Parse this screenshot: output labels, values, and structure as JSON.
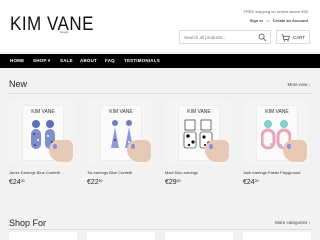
{
  "header": {
    "logo": "KIM VANE",
    "logo_sub": "design",
    "promo": "FREE shipping on orders above €30",
    "sign_in": "Sign in",
    "or": "or",
    "create_account": "Create an Account",
    "search_placeholder": "Search all products...",
    "cart_label": "CART"
  },
  "nav": {
    "items": [
      {
        "label": "HOME"
      },
      {
        "label": "SHOP ▾"
      },
      {
        "label": "SALE"
      },
      {
        "label": "ABOUT"
      },
      {
        "label": "FAQ"
      },
      {
        "label": "TESTIMONIALS"
      }
    ]
  },
  "new_section": {
    "title": "New",
    "more_link": "More new ›"
  },
  "products": [
    {
      "name": "Jamie Earrings Blue Confetti",
      "price_main": "€24",
      "price_cents": "00",
      "card_brand": "KIM VANE",
      "colors": [
        "#5e6fb5",
        "#9aa9d6",
        "#2f3f7a"
      ]
    },
    {
      "name": "Tia earrings Blue Confetti",
      "price_main": "€22",
      "price_cents": "50",
      "card_brand": "KIM VANE",
      "colors": [
        "#6b7fbf",
        "#b6c2e6",
        "#2e3a70"
      ]
    },
    {
      "name": "Mavi Moo earrings",
      "price_main": "€29",
      "price_cents": "00",
      "card_brand": "KIM VANE",
      "colors": [
        "#111111",
        "#ffffff",
        "#333333"
      ]
    },
    {
      "name": "Julie earrings Pastel Playground",
      "price_main": "€24",
      "price_cents": "00",
      "card_brand": "KIM VANE",
      "colors": [
        "#7fd1c9",
        "#e8a3b8",
        "#f0e6a6"
      ]
    }
  ],
  "shop_for": {
    "title": "Shop For",
    "more_link": "More categories ›"
  }
}
